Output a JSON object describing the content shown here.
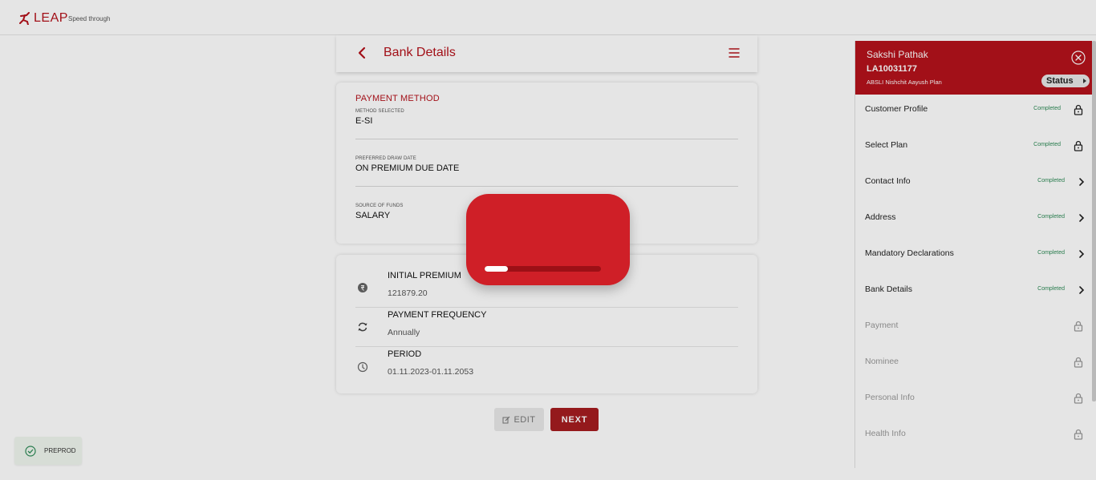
{
  "header": {
    "brand": "LEAP",
    "tagline": "Speed through"
  },
  "page": {
    "title": "Bank Details"
  },
  "payment_method": {
    "section_title": "PAYMENT METHOD",
    "fields": [
      {
        "label": "METHOD SELECTED",
        "value": "E-SI"
      },
      {
        "label": "PREFERRED DRAW DATE",
        "value": "ON PREMIUM DUE DATE"
      },
      {
        "label": "SOURCE OF FUNDS",
        "value": "SALARY"
      }
    ]
  },
  "summary": {
    "rows": [
      {
        "label": "INITIAL PREMIUM",
        "value": "121879.20",
        "icon": "rupee-coin-icon"
      },
      {
        "label": "PAYMENT FREQUENCY",
        "value": "Annually",
        "icon": "refresh-icon"
      },
      {
        "label": "PERIOD",
        "value": "01.11.2023-01.11.2053",
        "icon": "clock-icon"
      }
    ]
  },
  "actions": {
    "edit_label": "EDIT",
    "next_label": "NEXT"
  },
  "env_badge": {
    "label": "PREPROD"
  },
  "side_panel": {
    "customer_name": "Sakshi Pathak",
    "application_id": "LA10031177",
    "plan_name": "ABSLI Nishchit Aayush Plan",
    "status_label": "Status",
    "steps": [
      {
        "label": "Customer Profile",
        "status": "Completed",
        "icon": "lock-icon"
      },
      {
        "label": "Select Plan",
        "status": "Completed",
        "icon": "lock-icon"
      },
      {
        "label": "Contact Info",
        "status": "Completed",
        "icon": "chevron-right-icon"
      },
      {
        "label": "Address",
        "status": "Completed",
        "icon": "chevron-right-icon"
      },
      {
        "label": "Mandatory Declarations",
        "status": "Completed",
        "icon": "chevron-right-icon"
      },
      {
        "label": "Bank Details",
        "status": "Completed",
        "icon": "chevron-right-icon"
      },
      {
        "label": "Payment",
        "status": "",
        "icon": "lock-icon"
      },
      {
        "label": "Nominee",
        "status": "",
        "icon": "lock-icon"
      },
      {
        "label": "Personal Info",
        "status": "",
        "icon": "lock-icon"
      },
      {
        "label": "Health Info",
        "status": "",
        "icon": "lock-icon"
      }
    ]
  },
  "loader": {
    "progress_fraction": 0.2
  },
  "colors": {
    "brand_red": "#b5121b",
    "completed_green": "#2e8b57",
    "next_button": "#a51c20"
  }
}
